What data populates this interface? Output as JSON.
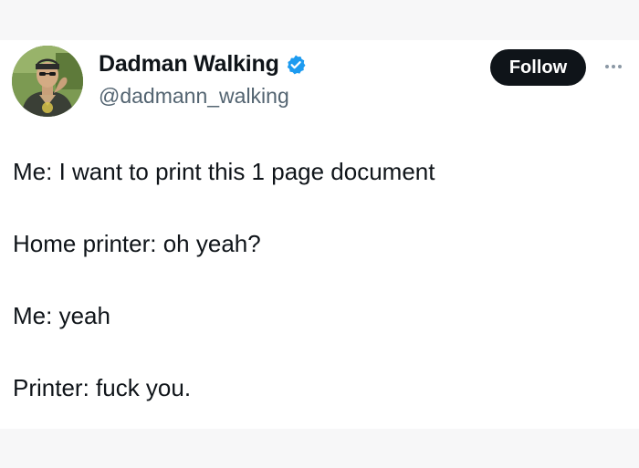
{
  "tweet": {
    "author": {
      "display_name": "Dadman Walking",
      "handle": "@dadmann_walking",
      "verified_icon": "verified-badge-icon",
      "avatar_icon": "profile-photo"
    },
    "follow_label": "Follow",
    "more_icon": "ellipsis-icon",
    "lines": [
      "Me: I want to print this 1 page document",
      "Home printer: oh yeah?",
      "Me: yeah",
      "Printer: fuck you."
    ]
  },
  "colors": {
    "page_background": "#f7f7f8",
    "card_background": "#ffffff",
    "text": "#0f1419",
    "secondary_text": "#536471",
    "follow_button": "#0f1419",
    "verified_blue": "#1d9bf0"
  }
}
